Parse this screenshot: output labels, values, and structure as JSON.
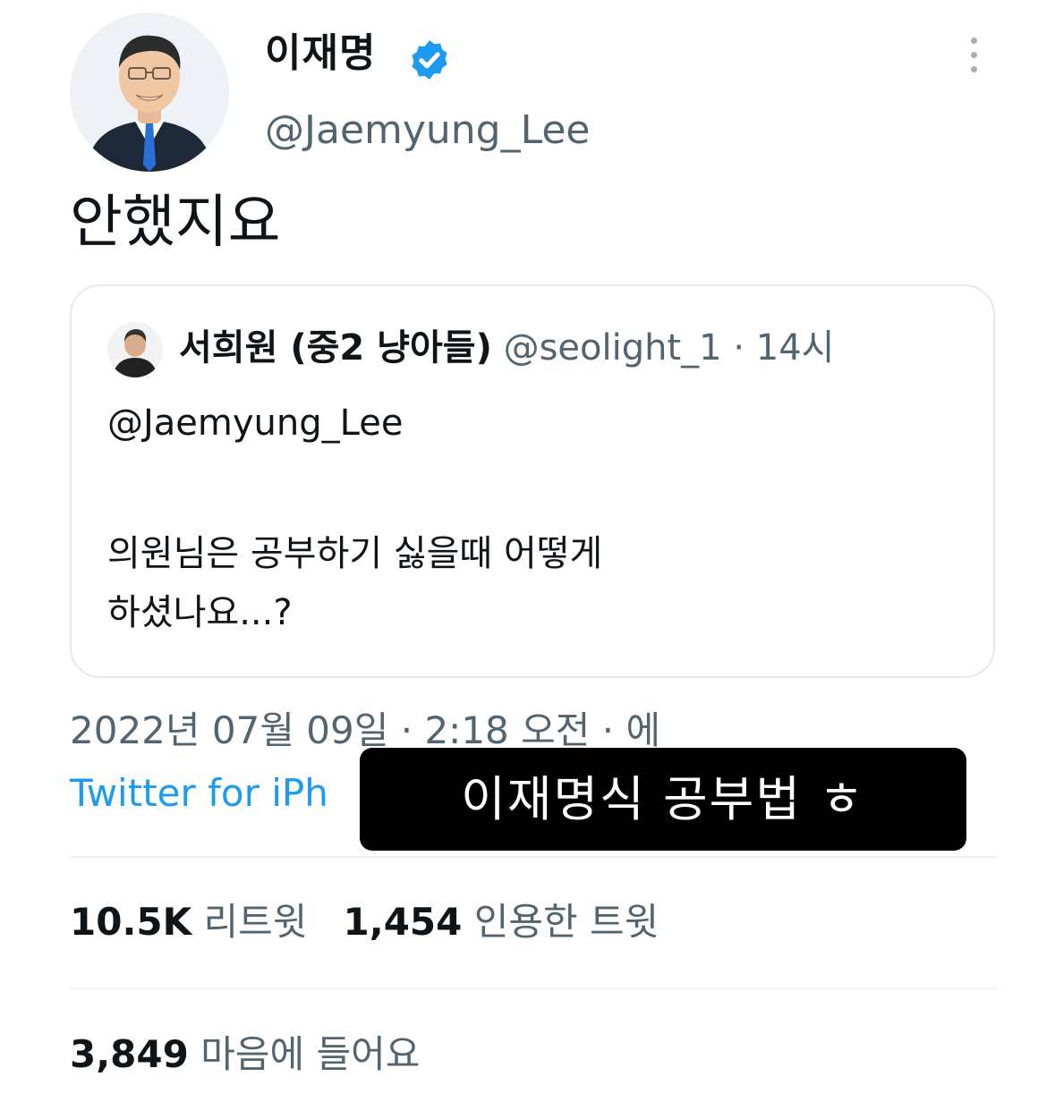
{
  "author": {
    "display_name": "이재명",
    "handle": "@Jaemyung_Lee",
    "verified_icon": "verified-badge-icon",
    "menu_icon": "more-vertical-icon"
  },
  "tweet": {
    "text": "안했지요"
  },
  "quoted_tweet": {
    "author_name": "서희원 (중2 냥아들)",
    "meta": "@seolight_1 · 14시",
    "mention": "@Jaemyung_Lee",
    "body_lines": [
      "의원님은 공부하기 싫을때 어떻게",
      "하셨나요...?"
    ]
  },
  "timestamp": "2022년 07월 09일 · 2:18 오전 · 에",
  "source": "Twitter for iPh",
  "caption": "이재명식 공부법 ㅎ",
  "stats": {
    "retweets_count": "10.5K",
    "retweets_label": "리트윗",
    "quotes_count": "1,454",
    "quotes_label": "인용한 트윗",
    "likes_count": "3,849",
    "likes_label": "마음에 들어요"
  },
  "colors": {
    "text_primary": "#0f1419",
    "text_secondary": "#536471",
    "link": "#1d9bf0",
    "verified": "#1d9bf0",
    "divider": "#eff3f4"
  }
}
